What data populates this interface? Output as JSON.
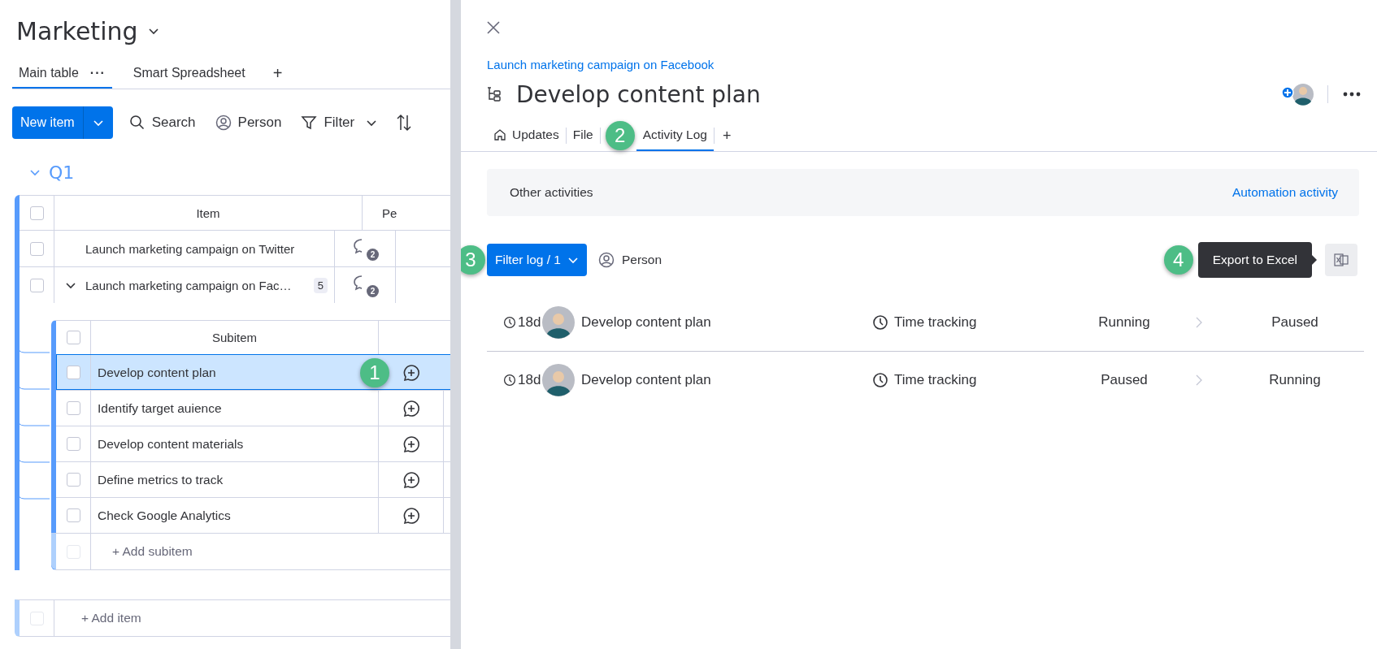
{
  "board": {
    "title": "Marketing",
    "views": [
      {
        "label": "Main table",
        "selected": true,
        "menu": "···"
      },
      {
        "label": "Smart Spreadsheet",
        "selected": false
      }
    ],
    "add_view": "+",
    "toolbar": {
      "new_item": "New item",
      "search": "Search",
      "person": "Person",
      "filter": "Filter"
    },
    "group": {
      "name": "Q1",
      "expanded": true,
      "header_checked": false,
      "columns": {
        "item": "Item",
        "column_3": "Pe"
      },
      "items": [
        {
          "name": "Launch marketing campaign on Twitter",
          "updates": "2",
          "expanded": false,
          "checked": false
        },
        {
          "name": "Launch marketing campaign on Fac…",
          "subitem_count": "5",
          "updates": "2",
          "expanded": true,
          "checked": false
        }
      ],
      "subitems": {
        "header": "Subitem",
        "header_checked": false,
        "rows": [
          {
            "name": "Develop content plan",
            "selected": true,
            "checked": false,
            "callout": "1"
          },
          {
            "name": "Identify target auience",
            "selected": false,
            "checked": false
          },
          {
            "name": "Develop content materials",
            "selected": false,
            "checked": false
          },
          {
            "name": "Define metrics to track",
            "selected": false,
            "checked": false
          },
          {
            "name": "Check Google Analytics",
            "selected": false,
            "checked": false
          }
        ],
        "add": {
          "label": "+ Add subitem",
          "checked": false
        }
      },
      "add_item": {
        "label": "+ Add item",
        "checked": false
      }
    }
  },
  "panel": {
    "parent_link": "Launch marketing campaign on Facebook",
    "title": "Develop content plan",
    "tabs": [
      {
        "label": "Updates",
        "kind": "home",
        "selected": false
      },
      {
        "label": "File",
        "kind": "plain",
        "selected": false
      },
      {
        "label": "Activity Log",
        "kind": "plain",
        "selected": true,
        "callout": "2"
      }
    ],
    "add_tab": "+",
    "other_activities": {
      "label": "Other activities",
      "link": "Automation activity"
    },
    "filter": {
      "label": "Filter log / 1",
      "callout": "3"
    },
    "person": "Person",
    "export": {
      "tooltip": "Export to Excel",
      "callout": "4"
    },
    "log": [
      {
        "time": "18d",
        "item": "Develop content plan",
        "column": "Time tracking",
        "from": "Running",
        "to": "Paused"
      },
      {
        "time": "18d",
        "item": "Develop content plan",
        "column": "Time tracking",
        "from": "Paused",
        "to": "Running"
      }
    ]
  }
}
